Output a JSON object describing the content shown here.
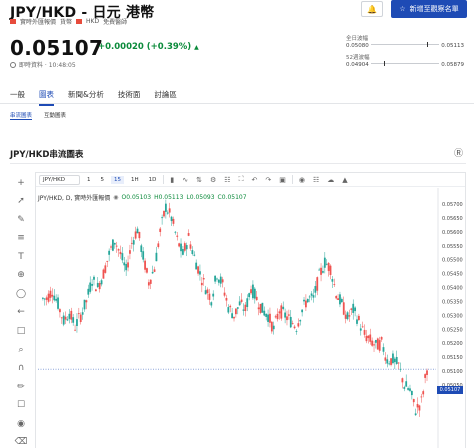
{
  "header": {
    "title": "JPY/HKD - 日元 港幣",
    "meta": [
      "實時外匯報價",
      "貨幣",
      "HKD",
      "免費醫師"
    ],
    "bell_icon": "bell-plus-icon",
    "watch_button": "新增至觀察名單",
    "price": "0.05107",
    "change": "+0.00020 (+0.39%)",
    "change_direction": "up",
    "timestamp": "即時資料 · 10:48:05"
  },
  "ranges": {
    "day": {
      "label": "全日波幅",
      "low": "0.05080",
      "high": "0.05113"
    },
    "week52": {
      "label": "52週波幅",
      "low": "0.04904",
      "high": "0.05879"
    }
  },
  "tabs": [
    "一般",
    "圖表",
    "新聞&分析",
    "技術面",
    "討論區"
  ],
  "active_tab": 1,
  "subtabs": [
    "串流圖表",
    "互動圖表"
  ],
  "active_subtab": 0,
  "section_title": "JPY/HKD串流圖表",
  "toolbar": {
    "symbol": "JPY/HKD",
    "timeframes": [
      "1",
      "5",
      "15",
      "1H",
      "1D"
    ],
    "active_timeframe": 2
  },
  "legend": {
    "title": "JPY/HKD, D, 實時外匯報價",
    "o": "O0.05103",
    "h": "H0.05113",
    "l": "L0.05093",
    "c": "C0.05107"
  },
  "price_tag": "0.05107",
  "colors": {
    "accent": "#1e4bb5",
    "up": "#0a8a3a",
    "up_candle": "#26a69a",
    "down_candle": "#ef5350"
  },
  "chart_data": {
    "type": "candlestick",
    "y_ticks": [
      "0.05700",
      "0.05650",
      "0.05600",
      "0.05550",
      "0.05500",
      "0.05450",
      "0.05400",
      "0.05350",
      "0.05300",
      "0.05250",
      "0.05200",
      "0.05150",
      "0.05100",
      "0.05050"
    ],
    "ylim": [
      0.05,
      0.0575
    ],
    "close_path": [
      0.0536,
      0.0539,
      0.0534,
      0.0528,
      0.0531,
      0.0526,
      0.053,
      0.0535,
      0.0543,
      0.054,
      0.0545,
      0.0552,
      0.0557,
      0.0552,
      0.0546,
      0.0556,
      0.0561,
      0.0551,
      0.0542,
      0.0547,
      0.056,
      0.0569,
      0.0565,
      0.0557,
      0.0552,
      0.0558,
      0.0551,
      0.0545,
      0.054,
      0.0536,
      0.0545,
      0.0541,
      0.0533,
      0.053,
      0.0534,
      0.0532,
      0.054,
      0.0536,
      0.0532,
      0.053,
      0.0525,
      0.0532,
      0.053,
      0.0528,
      0.0526,
      0.0532,
      0.0536,
      0.0536,
      0.0544,
      0.0549,
      0.0547,
      0.0538,
      0.0534,
      0.0529,
      0.0532,
      0.0528,
      0.0523,
      0.0521,
      0.0519,
      0.052,
      0.0514,
      0.0514,
      0.0512,
      0.0505,
      0.0503,
      0.0496,
      0.0499,
      0.0511
    ]
  }
}
